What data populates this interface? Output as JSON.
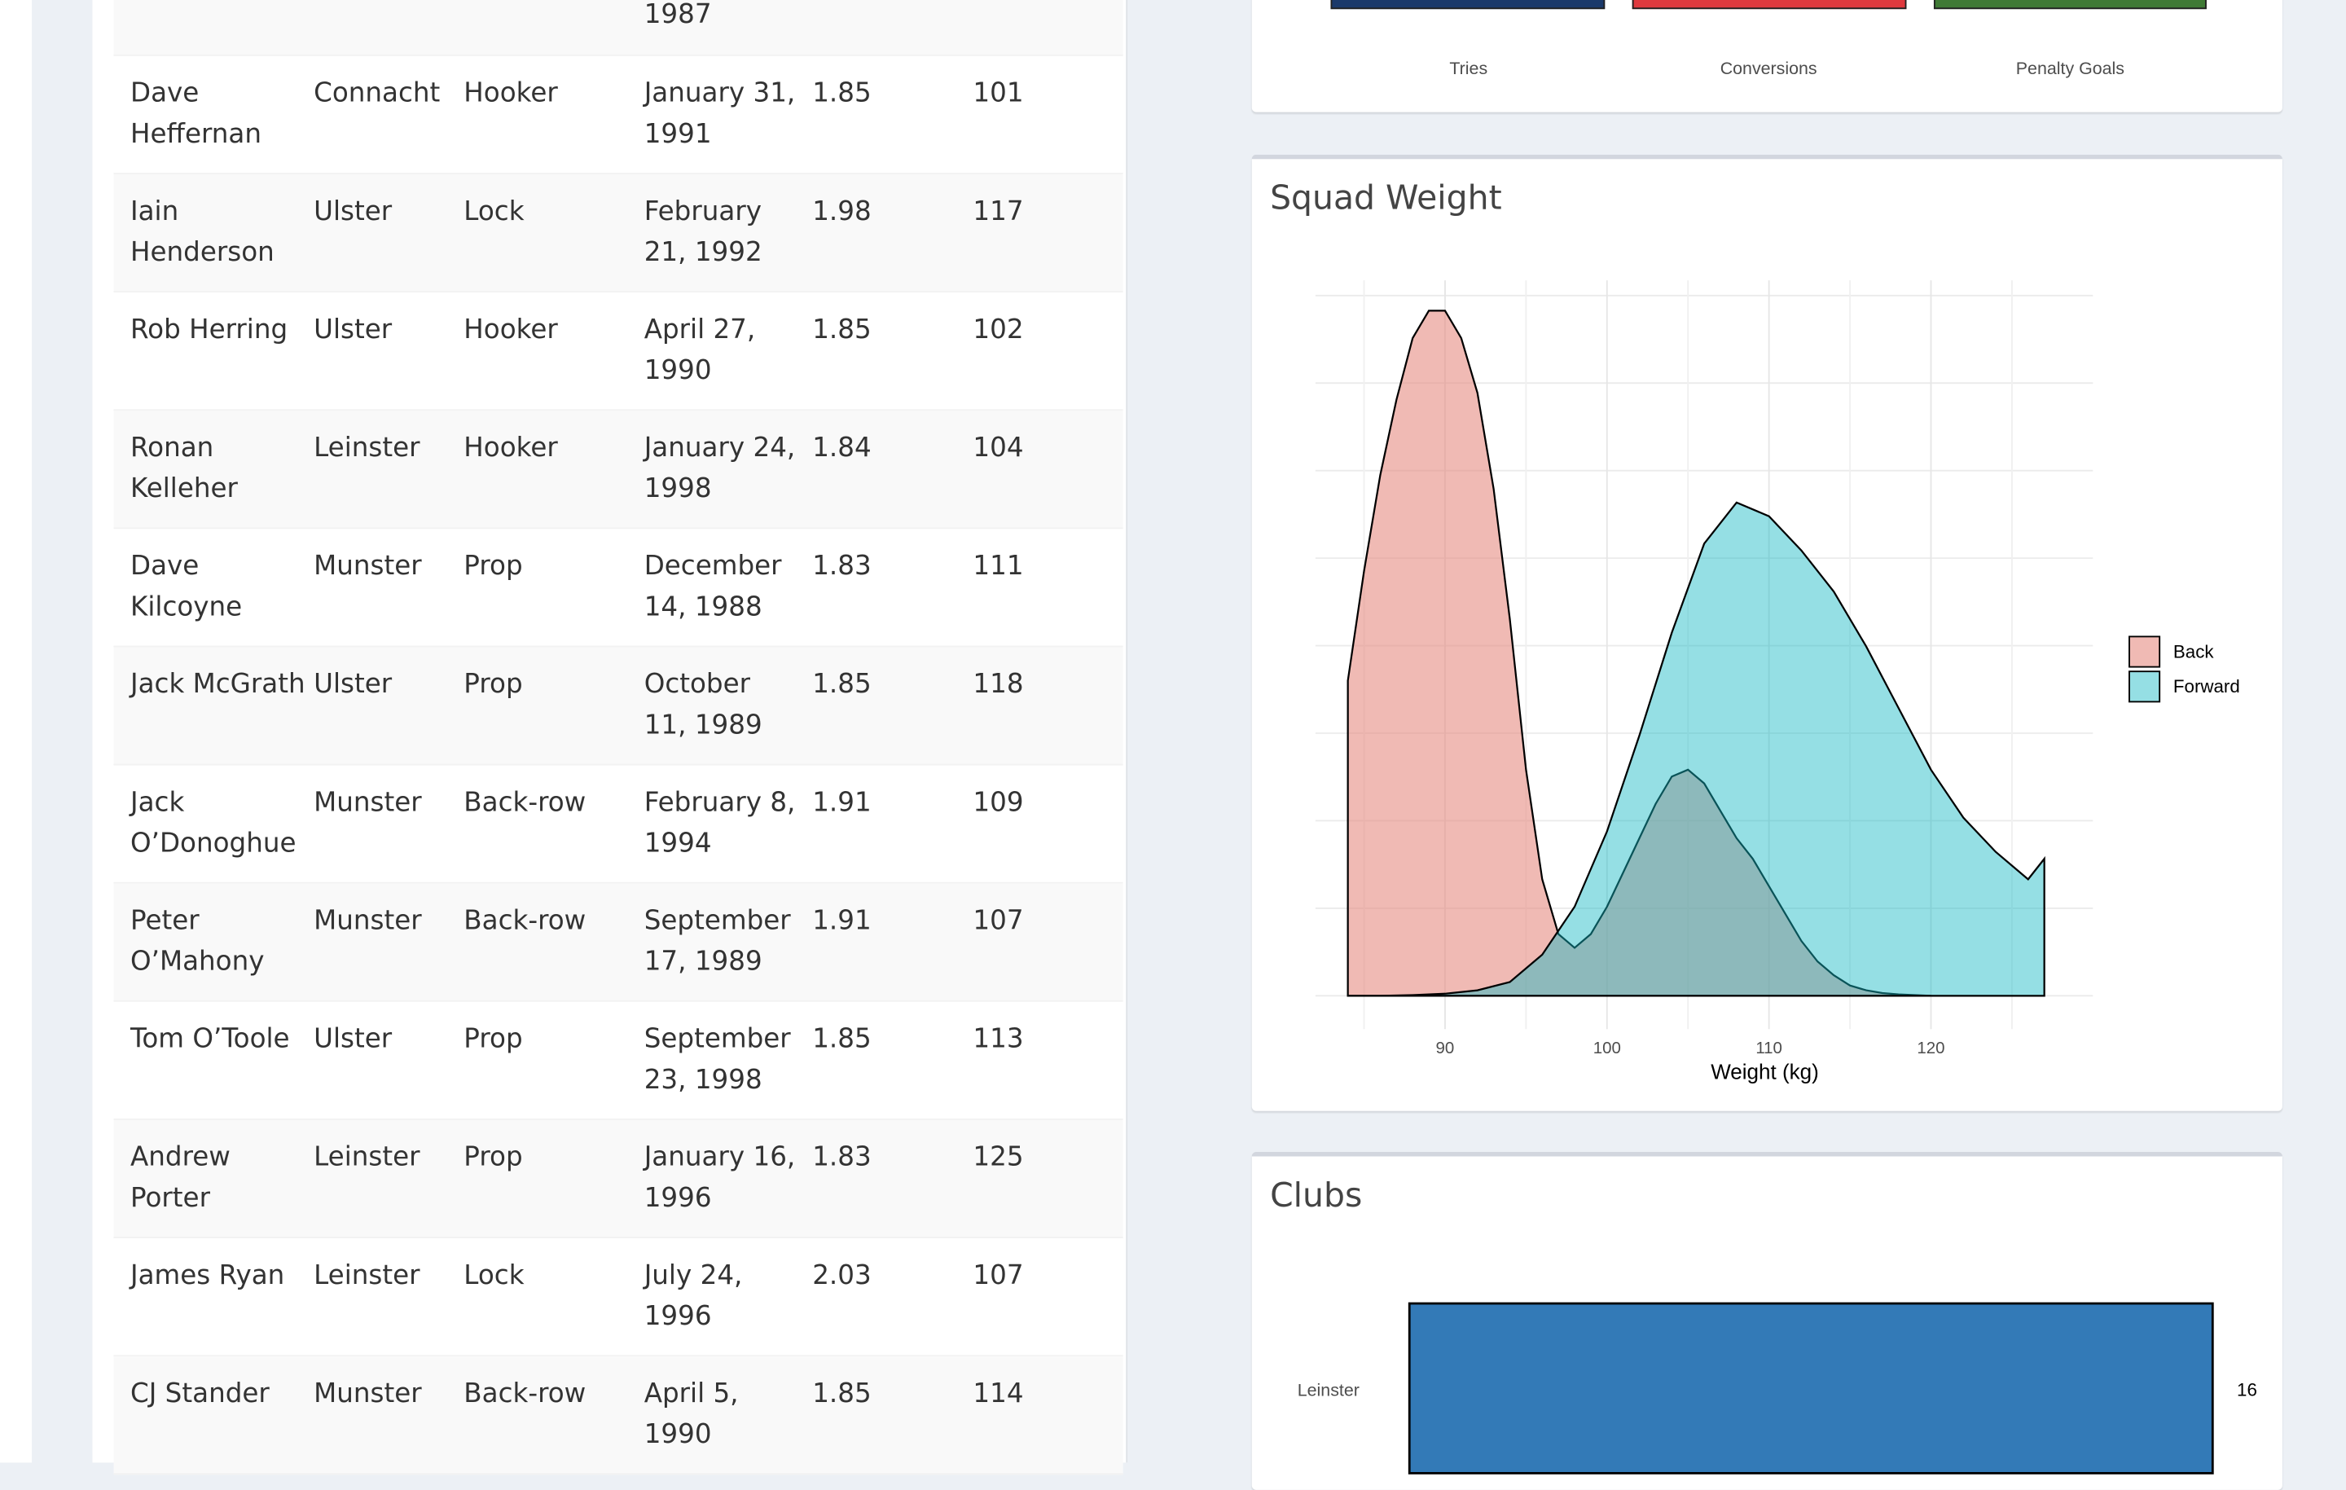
{
  "players_table": {
    "rows": [
      {
        "name": "",
        "club": "",
        "position": "",
        "dob": "1987",
        "height": "",
        "weight": "",
        "partial": true
      },
      {
        "name": "Dave Heffernan",
        "club": "Connacht",
        "position": "Hooker",
        "dob": "January 31, 1991",
        "height": "1.85",
        "weight": "101"
      },
      {
        "name": "Iain Henderson",
        "club": "Ulster",
        "position": "Lock",
        "dob": "February 21, 1992",
        "height": "1.98",
        "weight": "117"
      },
      {
        "name": "Rob Herring",
        "club": "Ulster",
        "position": "Hooker",
        "dob": "April 27, 1990",
        "height": "1.85",
        "weight": "102"
      },
      {
        "name": "Ronan Kelleher",
        "club": "Leinster",
        "position": "Hooker",
        "dob": "January 24, 1998",
        "height": "1.84",
        "weight": "104"
      },
      {
        "name": "Dave Kilcoyne",
        "club": "Munster",
        "position": "Prop",
        "dob": "December 14, 1988",
        "height": "1.83",
        "weight": "111"
      },
      {
        "name": "Jack McGrath",
        "club": "Ulster",
        "position": "Prop",
        "dob": "October 11, 1989",
        "height": "1.85",
        "weight": "118"
      },
      {
        "name": "Jack O’Donoghue",
        "club": "Munster",
        "position": "Back-row",
        "dob": "February 8, 1994",
        "height": "1.91",
        "weight": "109"
      },
      {
        "name": "Peter O’Mahony",
        "club": "Munster",
        "position": "Back-row",
        "dob": "September 17, 1989",
        "height": "1.91",
        "weight": "107"
      },
      {
        "name": "Tom O’Toole",
        "club": "Ulster",
        "position": "Prop",
        "dob": "September 23, 1998",
        "height": "1.85",
        "weight": "113"
      },
      {
        "name": "Andrew Porter",
        "club": "Leinster",
        "position": "Prop",
        "dob": "January 16, 1996",
        "height": "1.83",
        "weight": "125"
      },
      {
        "name": "James Ryan",
        "club": "Leinster",
        "position": "Lock",
        "dob": "July 24, 1996",
        "height": "2.03",
        "weight": "107"
      },
      {
        "name": "CJ Stander",
        "club": "Munster",
        "position": "Back-row",
        "dob": "April 5, 1990",
        "height": "1.85",
        "weight": "114"
      }
    ]
  },
  "scoring_box": {
    "labels": [
      "Tries",
      "Conversions",
      "Penalty Goals"
    ],
    "colors": [
      "#1b3a6b",
      "#e0393e",
      "#3f7a35"
    ]
  },
  "weight_box": {
    "title": "Squad Weight"
  },
  "clubs_box": {
    "title": "Clubs"
  },
  "chart_data": [
    {
      "type": "area",
      "subtype": "density",
      "title": "Squad Weight",
      "xlabel": "Weight (kg)",
      "ylabel": "",
      "xlim": [
        82,
        130
      ],
      "x_ticks": [
        90,
        100,
        110,
        120
      ],
      "grid": true,
      "legend": {
        "position": "right",
        "entries": [
          "Back",
          "Forward"
        ]
      },
      "series": [
        {
          "name": "Back",
          "color": "#F8766D",
          "x": [
            84,
            85,
            86,
            87,
            88,
            89,
            90,
            91,
            92,
            93,
            94,
            95,
            96,
            97,
            98,
            99,
            100,
            101,
            102,
            103,
            104,
            105,
            106,
            107,
            108,
            109,
            110,
            111,
            112,
            113,
            114,
            115,
            116,
            117,
            118,
            119,
            120
          ],
          "y": [
            0.46,
            0.62,
            0.76,
            0.87,
            0.96,
            1.0,
            1.0,
            0.96,
            0.88,
            0.74,
            0.55,
            0.33,
            0.17,
            0.09,
            0.07,
            0.09,
            0.13,
            0.18,
            0.23,
            0.28,
            0.32,
            0.33,
            0.31,
            0.27,
            0.23,
            0.2,
            0.16,
            0.12,
            0.08,
            0.05,
            0.03,
            0.015,
            0.008,
            0.004,
            0.002,
            0.001,
            0.0
          ]
        },
        {
          "name": "Forward",
          "color": "#00BFC4",
          "x": [
            84,
            86,
            88,
            90,
            92,
            94,
            96,
            98,
            100,
            102,
            104,
            106,
            108,
            110,
            112,
            114,
            116,
            118,
            120,
            122,
            124,
            126,
            127
          ],
          "y": [
            0.0,
            0.0,
            0.001,
            0.003,
            0.008,
            0.02,
            0.06,
            0.13,
            0.24,
            0.38,
            0.53,
            0.66,
            0.72,
            0.7,
            0.65,
            0.59,
            0.51,
            0.42,
            0.33,
            0.26,
            0.21,
            0.17,
            0.2
          ]
        }
      ]
    },
    {
      "type": "bar",
      "orientation": "horizontal",
      "title": "Clubs",
      "categories": [
        "Leinster"
      ],
      "values": [
        16
      ],
      "color": "#337ab7",
      "value_label": "16"
    }
  ]
}
